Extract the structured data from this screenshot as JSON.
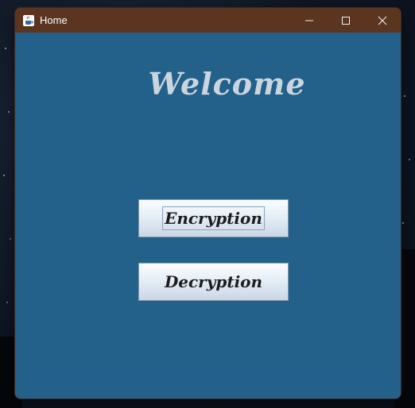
{
  "window": {
    "title": "Home",
    "icon": "java-cup-icon"
  },
  "controls": {
    "minimize": "minimize-icon",
    "maximize": "maximize-icon",
    "close": "close-icon"
  },
  "main": {
    "heading": "Welcome",
    "buttons": [
      {
        "label": "Encryption",
        "focused": true
      },
      {
        "label": "Decryption",
        "focused": false
      }
    ]
  },
  "colors": {
    "titlebar": "#5c3520",
    "client": "#23608a",
    "heading": "#c9d6df"
  }
}
